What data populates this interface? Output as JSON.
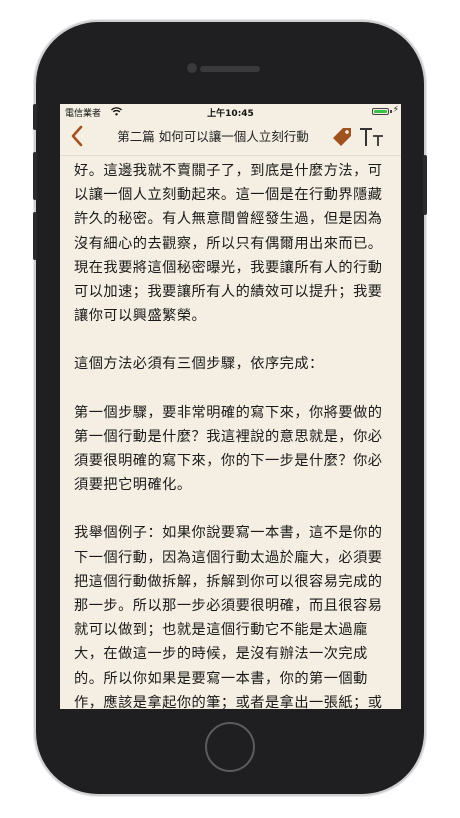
{
  "status": {
    "carrier": "電信業者",
    "time": "上午10:45"
  },
  "navbar": {
    "title": "第二篇 如何可以讓一個人立刻行動"
  },
  "content": {
    "paragraphs": [
      "好。這邊我就不賣關子了，到底是什麼方法，可以讓一個人立刻動起來。這一個是在行動界隱藏許久的秘密。有人無意間曾經發生過，但是因為沒有細心的去觀察，所以只有偶爾用出來而已。現在我要將這個秘密曝光，我要讓所有人的行動可以加速；我要讓所有人的績效可以提升；我要讓你可以興盛繁榮。",
      "這個方法必須有三個步驟，依序完成：",
      "第一個步驟，要非常明確的寫下來，你將要做的第一個行動是什麼？我這裡說的意思就是，你必須要很明確的寫下來，你的下一步是什麼？你必須要把它明確化。",
      "我舉個例子：如果你說要寫一本書，這不是你的下一個行動，因為這個行動太過於龐大，必須要把這個行動做拆解，拆解到你可以很容易完成的那一步。所以那一步必須要很明確，而且很容易就可以做到；也就是這個行動它不能是太過龐大，在做這一步的時候，是沒有辦法一次完成的。所以你如果是要寫一本書，你的第一個動作，應該是拿起你的筆；或者是拿出一張紙；或者是拿出你的手稿。我"
    ]
  },
  "icons": {
    "back": "chevron-left-icon",
    "tag": "tag-icon",
    "font": "font-size-icon",
    "wifi": "wifi-icon",
    "battery": "battery-icon"
  },
  "colors": {
    "accent": "#a0521e",
    "page_bg": "#f5efe3"
  }
}
